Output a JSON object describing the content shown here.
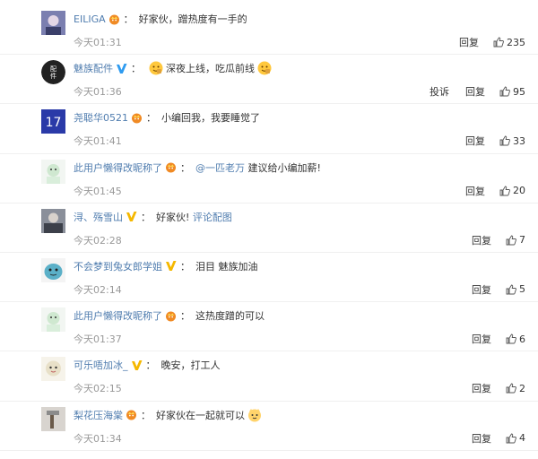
{
  "comments": [
    {
      "username": "EILIGA",
      "badge": "crown-badge",
      "text": "好家伙，蹭热度有一手的",
      "time": "今天01:31",
      "actions": [
        "回复"
      ],
      "likes": "235",
      "avatar_color": "#7b7fb0"
    },
    {
      "username": "魅族配件",
      "badge": "verified-v-blue",
      "text_parts": [
        "深夜上线，吃瓜前线"
      ],
      "time": "今天01:36",
      "actions": [
        "投诉",
        "回复"
      ],
      "likes": "95",
      "avatar_text": "配件",
      "avatar_color": "#222222"
    },
    {
      "username": "尧聪华0521",
      "badge": "crown-badge",
      "text": "小编回我，我要睡觉了",
      "time": "今天01:41",
      "actions": [
        "回复"
      ],
      "likes": "33",
      "avatar_text": "17",
      "avatar_color": "#2a3aa8"
    },
    {
      "username": "此用户懒得改昵称了",
      "badge": "crown-badge",
      "mention": "@一匹老万",
      "text": "建议给小编加薪!",
      "time": "今天01:45",
      "actions": [
        "回复"
      ],
      "likes": "20",
      "avatar_color": "#cfe8d0"
    },
    {
      "username": "浔、殇雪山",
      "badge": "verified-v-yellow",
      "text": "好家伙!",
      "link_text": "评论配图",
      "time": "今天02:28",
      "actions": [
        "回复"
      ],
      "likes": "7",
      "avatar_color": "#555a66"
    },
    {
      "username": "不会梦到兔女郎学姐",
      "badge": "verified-v-yellow",
      "text": "泪目 魅族加油",
      "time": "今天02:14",
      "actions": [
        "回复"
      ],
      "likes": "5",
      "avatar_color": "#5bb0c8"
    },
    {
      "username": "此用户懒得改昵称了",
      "badge": "crown-badge",
      "text": "这热度蹭的可以",
      "time": "今天01:37",
      "actions": [
        "回复"
      ],
      "likes": "6",
      "avatar_color": "#cfe8d0"
    },
    {
      "username": "可乐唔加冰_",
      "badge": "verified-v-yellow",
      "text": "晚安，打工人",
      "time": "今天02:15",
      "actions": [
        "回复"
      ],
      "likes": "2",
      "avatar_color": "#e8e0c8"
    },
    {
      "username": "梨花压海棠",
      "badge": "crown-badge",
      "text": "好家伙在一起就可以",
      "time": "今天01:34",
      "actions": [
        "回复"
      ],
      "likes": "4",
      "avatar_color": "#b0a8a0"
    }
  ],
  "colors": {
    "username": "#507daf",
    "crown": "#f08a24",
    "verified_blue": "#2e9bf0",
    "verified_yellow": "#f5b800",
    "time": "#999999"
  }
}
